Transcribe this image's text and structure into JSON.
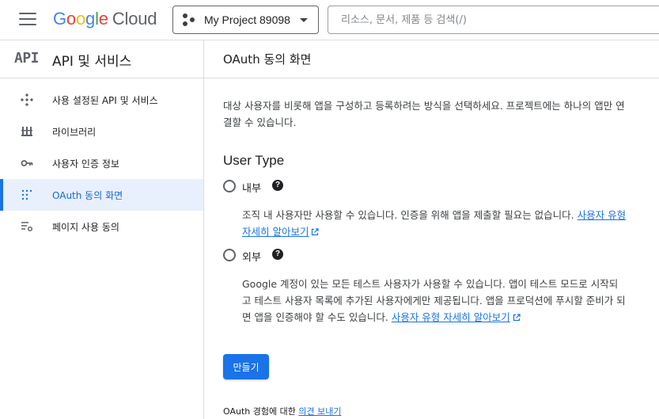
{
  "topbar": {
    "logo_letters": [
      "G",
      "o",
      "o",
      "g",
      "l",
      "e"
    ],
    "logo_product": "Cloud",
    "project_name": "My Project 89098",
    "search_placeholder": "리소스, 문서, 제품 등 검색(/)"
  },
  "sidebar": {
    "badge": "API",
    "title": "API 및 서비스",
    "items": [
      {
        "label": "사용 설정된 API 및 서비스",
        "icon": "api-diamond-icon",
        "active": false
      },
      {
        "label": "라이브러리",
        "icon": "library-icon",
        "active": false
      },
      {
        "label": "사용자 인증 정보",
        "icon": "key-icon",
        "active": false
      },
      {
        "label": "OAuth 동의 화면",
        "icon": "oauth-dots-icon",
        "active": true
      },
      {
        "label": "페이지 사용 동의",
        "icon": "settings-list-icon",
        "active": false
      }
    ]
  },
  "main": {
    "title": "OAuth 동의 화면",
    "intro": "대상 사용자를 비롯해 앱을 구성하고 등록하려는 방식을 선택하세요. 프로젝트에는 하나의 앱만 연결할 수 있습니다.",
    "user_type_title": "User Type",
    "internal": {
      "label": "내부",
      "description": "조직 내 사용자만 사용할 수 있습니다. 인증을 위해 앱을 제출할 필요는 없습니다.",
      "link": "사용자 유형 자세히 알아보기"
    },
    "external": {
      "label": "외부",
      "description": "Google 계정이 있는 모든 테스트 사용자가 사용할 수 있습니다. 앱이 테스트 모드로 시작되고 테스트 사용자 목록에 추가된 사용자에게만 제공됩니다. 앱을 프로덕션에 푸시할 준비가 되면 앱을 인증해야 할 수도 있습니다.",
      "link": "사용자 유형 자세히 알아보기"
    },
    "help_glyph": "?",
    "create_label": "만들기",
    "feedback_text": "OAuth 경험에 대한",
    "feedback_link": "의견 보내기"
  },
  "colors": {
    "accent": "#1a73e8",
    "active_bg": "#e8f0fe",
    "border": "#dadce0"
  }
}
